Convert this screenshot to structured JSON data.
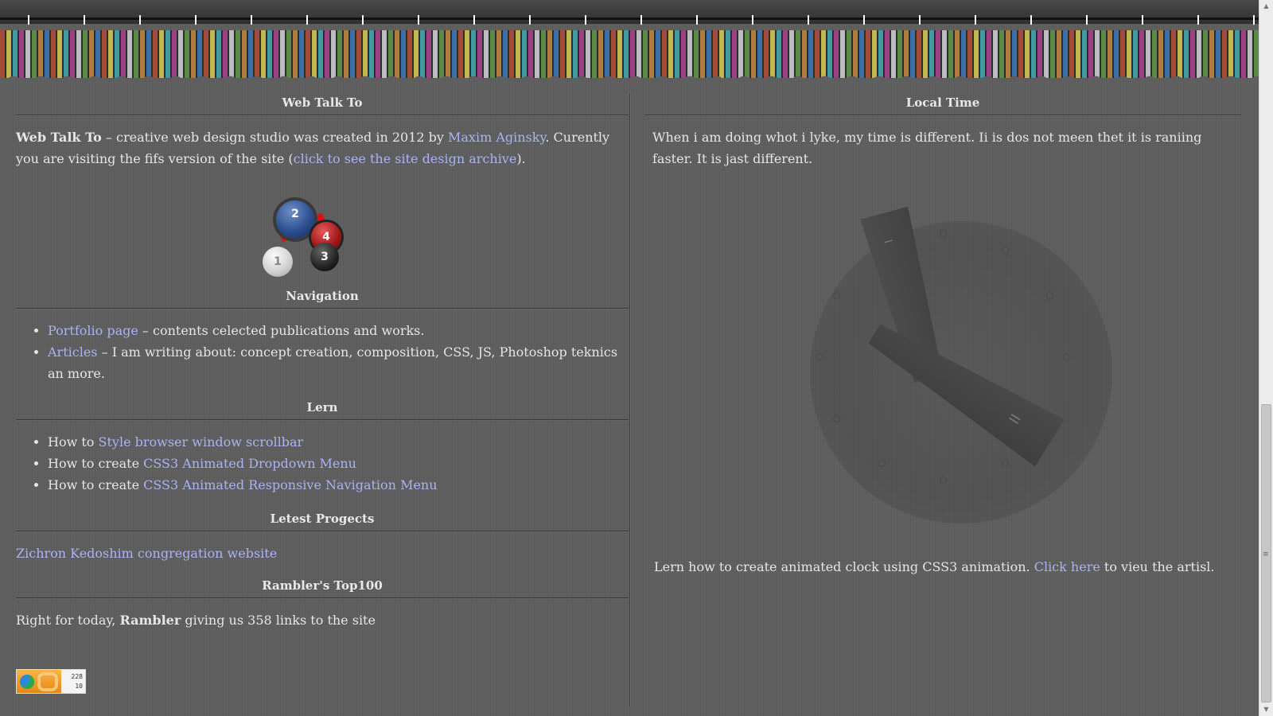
{
  "header": {
    "decoration": "pencil-ruler-banner"
  },
  "left": {
    "web_talk": {
      "title": "Web Talk To",
      "brand": "Web Talk To",
      "text1": " – creative web design studio was created in 2012 by ",
      "author_link": "Maxim Aginsky",
      "text2": ". Curently you are visiting the fifs version of the site (",
      "archive_link": "click to see the site design archive",
      "text3": ")."
    },
    "logo": {
      "balls": [
        "1",
        "2",
        "3",
        "4"
      ]
    },
    "navigation": {
      "title": "Navigation",
      "items": [
        {
          "link": "Portfolio page",
          "text": " – contents celected publications and works."
        },
        {
          "link": "Articles",
          "text": " – I am writing about: concept creation, composition, CSS, JS, Photoshop teknics an more."
        }
      ]
    },
    "lern": {
      "title": "Lern",
      "items": [
        {
          "prefix": "How to ",
          "link": "Style browser window scrollbar"
        },
        {
          "prefix": "How to create ",
          "link": "CSS3 Animated Dropdown Menu"
        },
        {
          "prefix": "How to create ",
          "link": "CSS3 Animated Responsive Navigation Menu"
        }
      ]
    },
    "projects": {
      "title": "Letest Progects",
      "link": "Zichron Kedoshim congregation website"
    },
    "rambler": {
      "title": "Rambler's Top100",
      "text1": "Right for today, ",
      "brand": "Rambler",
      "text2": " giving us 358 links to the site",
      "counter_top": "228",
      "counter_bottom": "10"
    }
  },
  "right": {
    "local_time": {
      "title": "Local Time",
      "text": "When i am doing whot i lyke, my time is different. Ii is dos not meen thet it is raniing faster. It is jast different."
    },
    "clock": {
      "hour_mark": "I",
      "minute_mark": "II"
    },
    "article": {
      "text1": "Lern how to create animated clock using CSS3 animation. ",
      "link": "Click here",
      "text2": " to vieu the artisl."
    }
  },
  "colors": {
    "link": "#a9b4f2",
    "background": "#5f5f5f",
    "text": "#e6e6e6"
  }
}
